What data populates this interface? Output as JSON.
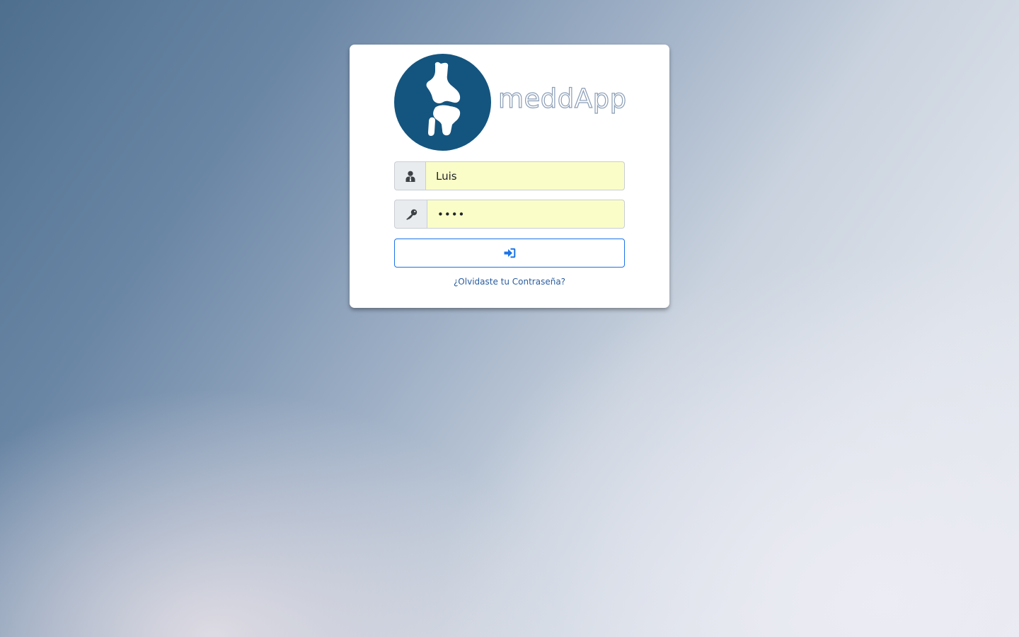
{
  "brand": {
    "name": "meddApp",
    "logo_icon": "knee-joint-icon",
    "logo_color": "#14557f"
  },
  "login": {
    "username_icon": "user-icon",
    "username_value": "Luis",
    "password_icon": "key-icon",
    "password_value": "abcd",
    "submit_icon": "sign-in-icon",
    "forgot_password": "¿Olvidaste tu Contraseña?"
  },
  "colors": {
    "field_autofill": "#fafdc7",
    "button_accent": "#1a73e8",
    "link": "#2a5d9f"
  }
}
